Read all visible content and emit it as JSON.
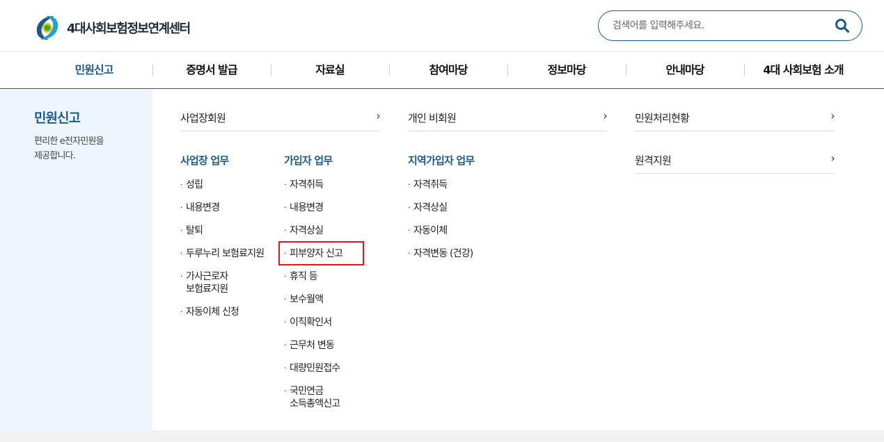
{
  "header": {
    "logo_text": "4대사회보험정보연계센터",
    "search_placeholder": "검색어를 입력해주세요."
  },
  "gnb": {
    "items": [
      {
        "label": "민원신고",
        "active": true
      },
      {
        "label": "증명서 발급"
      },
      {
        "label": "자료실"
      },
      {
        "label": "참여마당"
      },
      {
        "label": "정보마당"
      },
      {
        "label": "안내마당"
      },
      {
        "label": "4대 사회보험 소개"
      }
    ]
  },
  "mega": {
    "side_title": "민원신고",
    "side_desc_line1": "편리한 e전자민원을",
    "side_desc_line2": "제공합니다.",
    "col1": {
      "title": "사업장회원",
      "group1": {
        "title": "사업장 업무",
        "links": [
          "성립",
          "내용변경",
          "탈퇴",
          "두루누리 보험료지원",
          "가사근로자",
          "보험료지원",
          "자동이체 신청"
        ]
      },
      "group2": {
        "title": "가입자 업무",
        "links": [
          "자격취득",
          "내용변경",
          "자격상실",
          "피부양자 신고",
          "휴직 등",
          "보수월액",
          "이직확인서",
          "근무처 변동",
          "대량민원접수",
          "국민연금",
          "소득총액신고"
        ]
      }
    },
    "col2": {
      "title": "개인 비회원",
      "group1": {
        "title": "지역가입자 업무",
        "links": [
          "자격취득",
          "자격상실",
          "자동이체",
          "자격변동 (건강)"
        ]
      }
    },
    "col3": {
      "items": [
        "민원처리현황",
        "원격지원"
      ]
    }
  },
  "icons": {
    "chevron": "›",
    "bullet": "·"
  },
  "colors": {
    "brand_blue": "#1d5a8c",
    "highlight_red": "#e8141a",
    "side_bg": "#eef5fd"
  }
}
